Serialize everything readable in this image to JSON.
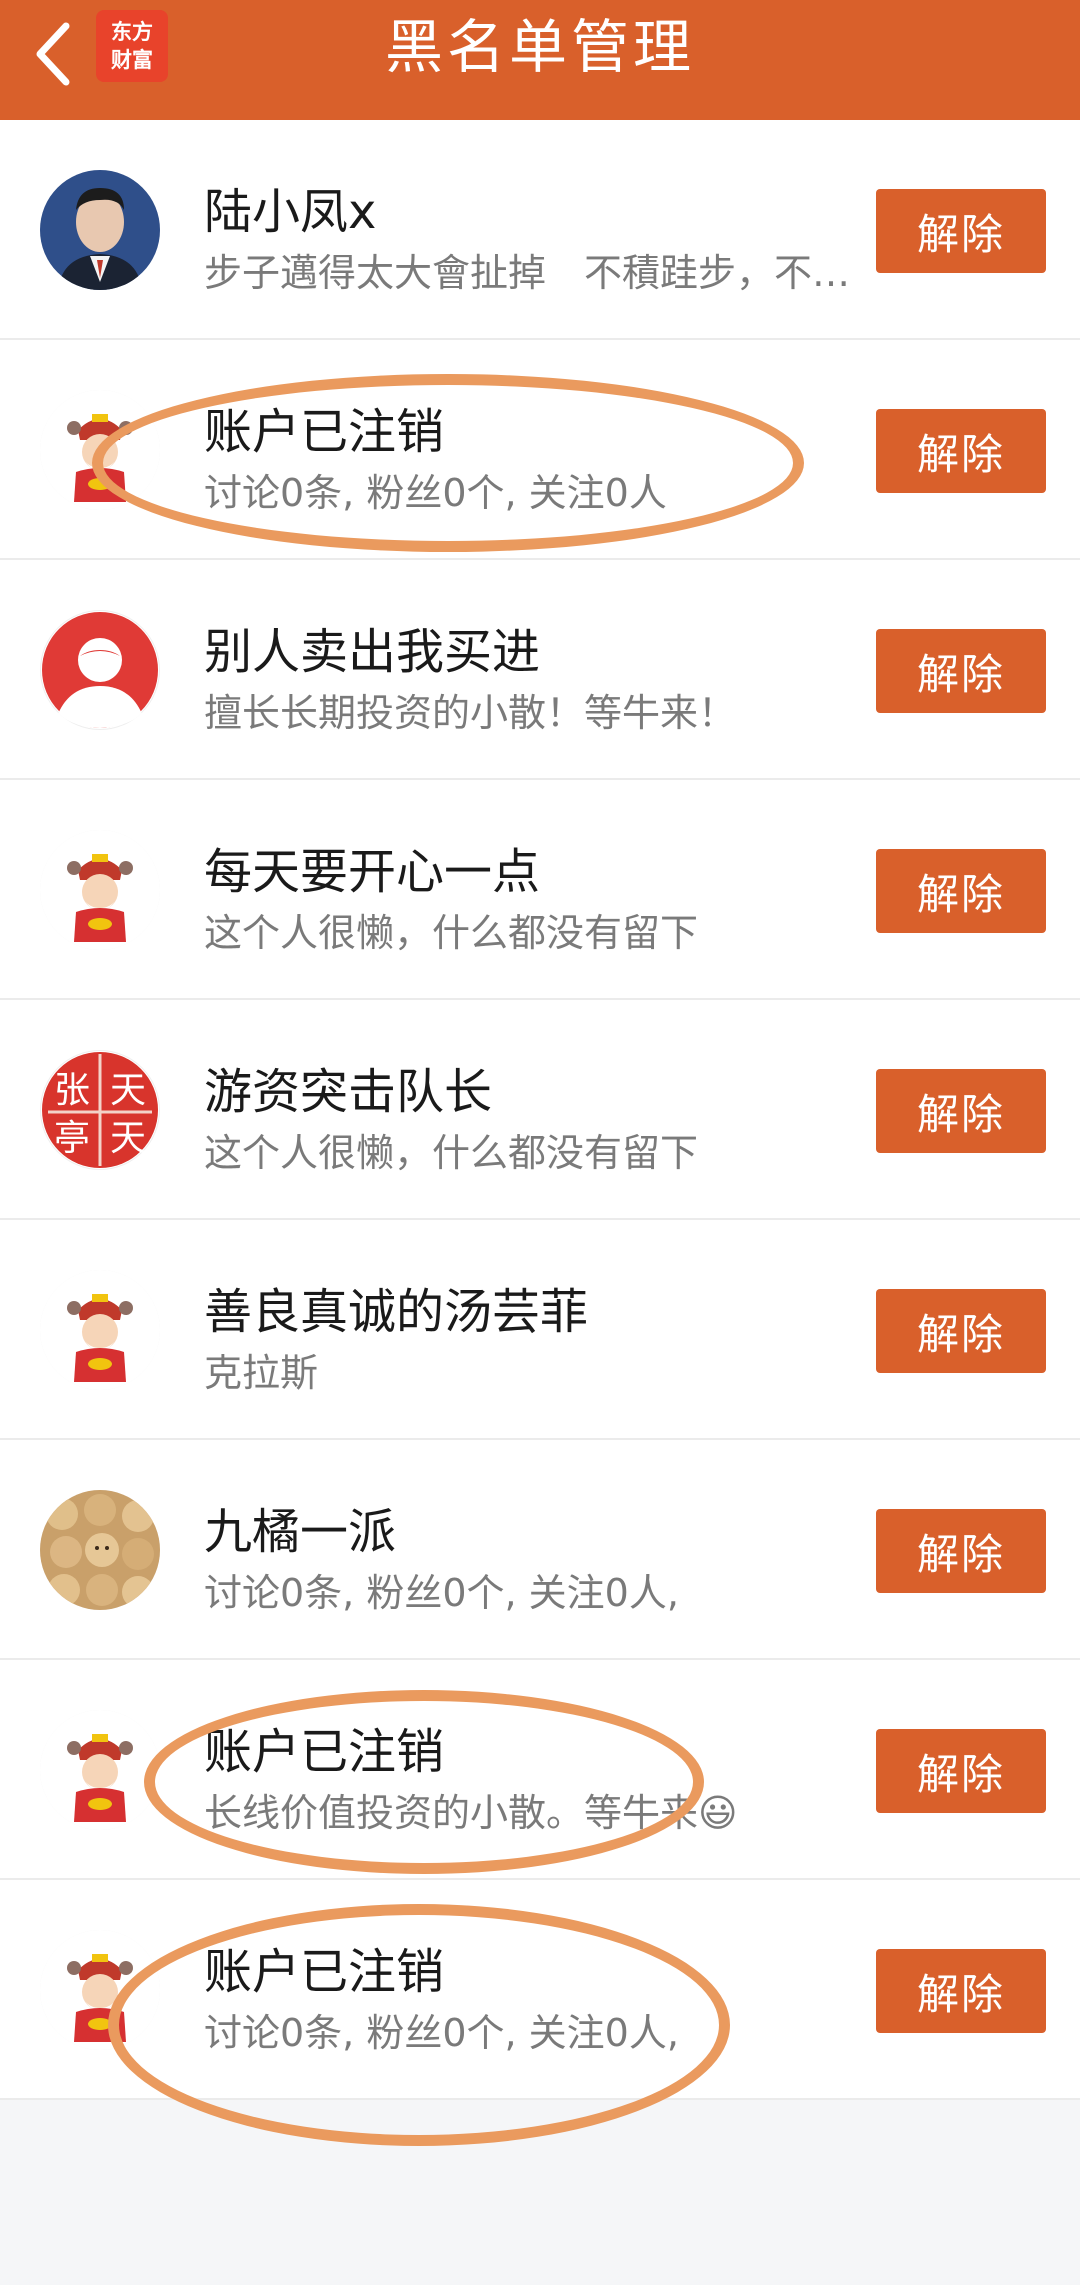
{
  "header": {
    "title": "黑名单管理",
    "back_icon": "chevron-left-icon",
    "logo_line1": "东方",
    "logo_line2": "财富"
  },
  "remove_label": "解除",
  "items": [
    {
      "name": "陆小凤x",
      "desc": "步子邁得太大會扯掉　不積跬步，不能走到千里",
      "avatar": "photo-man-suit"
    },
    {
      "name": "账户已注销",
      "desc": "讨论0条, 粉丝0个, 关注0人",
      "avatar": "god-of-wealth"
    },
    {
      "name": "别人卖出我买进",
      "desc": "擅长长期投资的小散！等牛来！",
      "avatar": "red-default-avatar"
    },
    {
      "name": "每天要开心一点",
      "desc": "这个人很懒，什么都没有留下",
      "avatar": "god-of-wealth"
    },
    {
      "name": "游资突击队长",
      "desc": "这个人很懒，什么都没有留下",
      "avatar": "red-calligraphy"
    },
    {
      "name": "善良真诚的汤芸菲",
      "desc": "克拉斯",
      "avatar": "god-of-wealth"
    },
    {
      "name": "九橘一派",
      "desc": "讨论0条, 粉丝0个, 关注0人,",
      "avatar": "alpaca-photo"
    },
    {
      "name": "账户已注销",
      "desc": "长线价值投资的小散。等牛来😃",
      "avatar": "god-of-wealth"
    },
    {
      "name": "账户已注销",
      "desc": "讨论0条, 粉丝0个, 关注0人,",
      "avatar": "god-of-wealth"
    }
  ],
  "calligraphy": [
    "张",
    "天",
    "亭",
    "天"
  ],
  "colors": {
    "accent": "#d9602b",
    "annotation": "#ea9a5e"
  }
}
